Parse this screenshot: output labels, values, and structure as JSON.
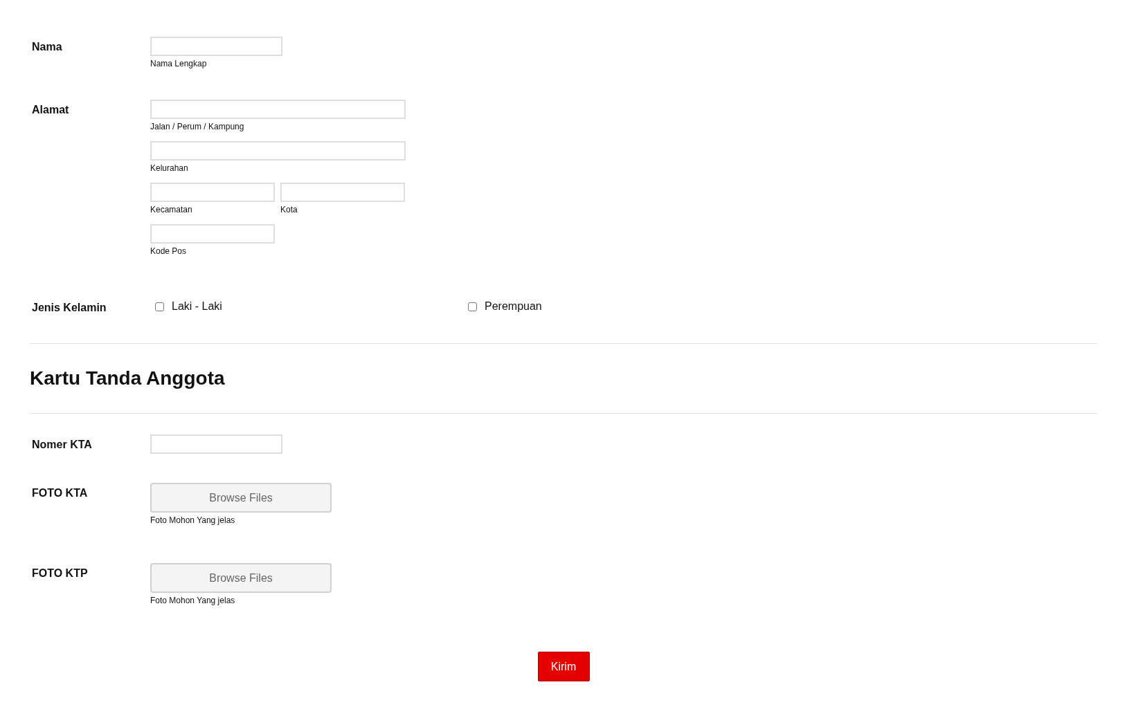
{
  "sections": [
    {
      "kind": "fields",
      "rows": [
        {
          "kind": "text",
          "label": "Nama",
          "lines": [
            [
              {
                "sublabel": "Nama Lengkap"
              }
            ]
          ]
        },
        {
          "kind": "text",
          "label": "Alamat",
          "lines": [
            [
              {
                "sublabel": "Jalan / Perum / Kampung"
              }
            ],
            [
              {
                "sublabel": "Kelurahan"
              }
            ],
            [
              {
                "sublabel": "Kecamatan"
              },
              {
                "sublabel": "Kota"
              }
            ],
            [
              {
                "sublabel": "Kode Pos"
              }
            ]
          ]
        },
        {
          "kind": "checks",
          "label": "Jenis Kelamin",
          "options": [
            {
              "label": "Laki - Laki",
              "checked": false
            },
            {
              "label": "Perempuan",
              "checked": false
            }
          ]
        }
      ]
    },
    {
      "kind": "heading",
      "title": "Kartu Tanda Anggota"
    },
    {
      "kind": "fields",
      "rows": [
        {
          "kind": "text",
          "label": "Nomer KTA"
        },
        {
          "kind": "file",
          "label": "FOTO KTA",
          "button": "Browse Files",
          "sublabel": "Foto Mohon Yang jelas"
        },
        {
          "kind": "file",
          "label": "FOTO KTP",
          "button": "Browse Files",
          "sublabel": "Foto Mohon Yang jelas"
        }
      ]
    }
  ],
  "submit": "Kirim"
}
